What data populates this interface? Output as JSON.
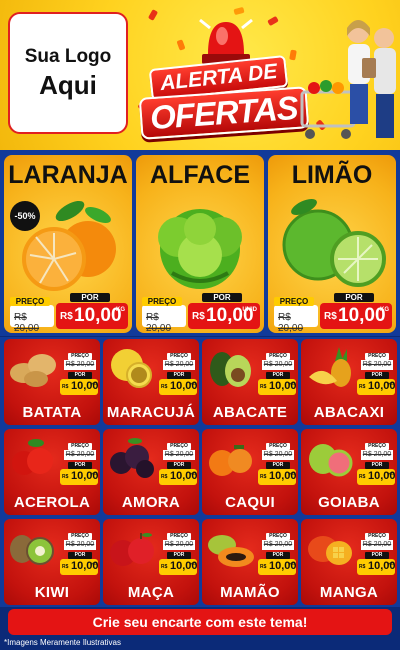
{
  "logo": {
    "line1": "Sua Logo",
    "line2": "Aqui"
  },
  "banner": {
    "line1": "ALERTA DE",
    "line2": "OFERTAS"
  },
  "colors": {
    "header_yellow": "#ffd21f",
    "red": "#e41414",
    "blue": "#113a9a",
    "price_yellow": "#ffcc00"
  },
  "featured": [
    {
      "name": "LARANJA",
      "icon": "orange-icon",
      "discount": "-50%",
      "old_label": "PREÇO",
      "old_price": "R$ 20,00",
      "new_label": "POR",
      "currency": "R$",
      "price": "10,00",
      "unit": "KG"
    },
    {
      "name": "ALFACE",
      "icon": "lettuce-icon",
      "old_label": "PREÇO",
      "old_price": "R$ 20,00",
      "new_label": "POR",
      "currency": "R$",
      "price": "10,00",
      "unit": "UNID"
    },
    {
      "name": "LIMÃO",
      "icon": "lime-icon",
      "old_label": "PREÇO",
      "old_price": "R$ 20,00",
      "new_label": "POR",
      "currency": "R$",
      "price": "10,00",
      "unit": "KG"
    }
  ],
  "products": [
    {
      "name": "BATATA",
      "icon": "potato-icon",
      "old_label": "PREÇO",
      "old_price": "R$ 20,00",
      "new_label": "POR",
      "currency": "R$",
      "price": "10,00",
      "unit": "KG"
    },
    {
      "name": "MARACUJÁ",
      "icon": "passion-fruit-icon",
      "old_label": "PREÇO",
      "old_price": "R$ 20,00",
      "new_label": "POR",
      "currency": "R$",
      "price": "10,00",
      "unit": "KG"
    },
    {
      "name": "ABACATE",
      "icon": "avocado-icon",
      "old_label": "PREÇO",
      "old_price": "R$ 20,00",
      "new_label": "POR",
      "currency": "R$",
      "price": "10,00",
      "unit": "KG"
    },
    {
      "name": "ABACAXI",
      "icon": "pineapple-icon",
      "old_label": "PREÇO",
      "old_price": "R$ 20,00",
      "new_label": "POR",
      "currency": "R$",
      "price": "10,00",
      "unit": "KG"
    },
    {
      "name": "ACEROLA",
      "icon": "acerola-icon",
      "old_label": "PREÇO",
      "old_price": "R$ 20,00",
      "new_label": "POR",
      "currency": "R$",
      "price": "10,00",
      "unit": "KG"
    },
    {
      "name": "AMORA",
      "icon": "blackberry-icon",
      "old_label": "PREÇO",
      "old_price": "R$ 20,00",
      "new_label": "POR",
      "currency": "R$",
      "price": "10,00",
      "unit": "KG"
    },
    {
      "name": "CAQUI",
      "icon": "persimmon-icon",
      "old_label": "PREÇO",
      "old_price": "R$ 20,00",
      "new_label": "POR",
      "currency": "R$",
      "price": "10,00",
      "unit": "KG"
    },
    {
      "name": "GOIABA",
      "icon": "guava-icon",
      "old_label": "PREÇO",
      "old_price": "R$ 20,00",
      "new_label": "POR",
      "currency": "R$",
      "price": "10,00",
      "unit": "KG"
    },
    {
      "name": "KIWI",
      "icon": "kiwi-icon",
      "old_label": "PREÇO",
      "old_price": "R$ 20,00",
      "new_label": "POR",
      "currency": "R$",
      "price": "10,00",
      "unit": "KG"
    },
    {
      "name": "MAÇA",
      "icon": "apple-icon",
      "old_label": "PREÇO",
      "old_price": "R$ 20,00",
      "new_label": "POR",
      "currency": "R$",
      "price": "10,00",
      "unit": "KG"
    },
    {
      "name": "MAMÃO",
      "icon": "papaya-icon",
      "old_label": "PREÇO",
      "old_price": "R$ 20,00",
      "new_label": "POR",
      "currency": "R$",
      "price": "10,00",
      "unit": "KG"
    },
    {
      "name": "MANGA",
      "icon": "mango-icon",
      "old_label": "PREÇO",
      "old_price": "R$ 20,00",
      "new_label": "POR",
      "currency": "R$",
      "price": "10,00",
      "unit": "KG"
    }
  ],
  "cta": "Crie seu encarte com este tema!",
  "footnote": "*Imagens Meramente Ilustrativas"
}
